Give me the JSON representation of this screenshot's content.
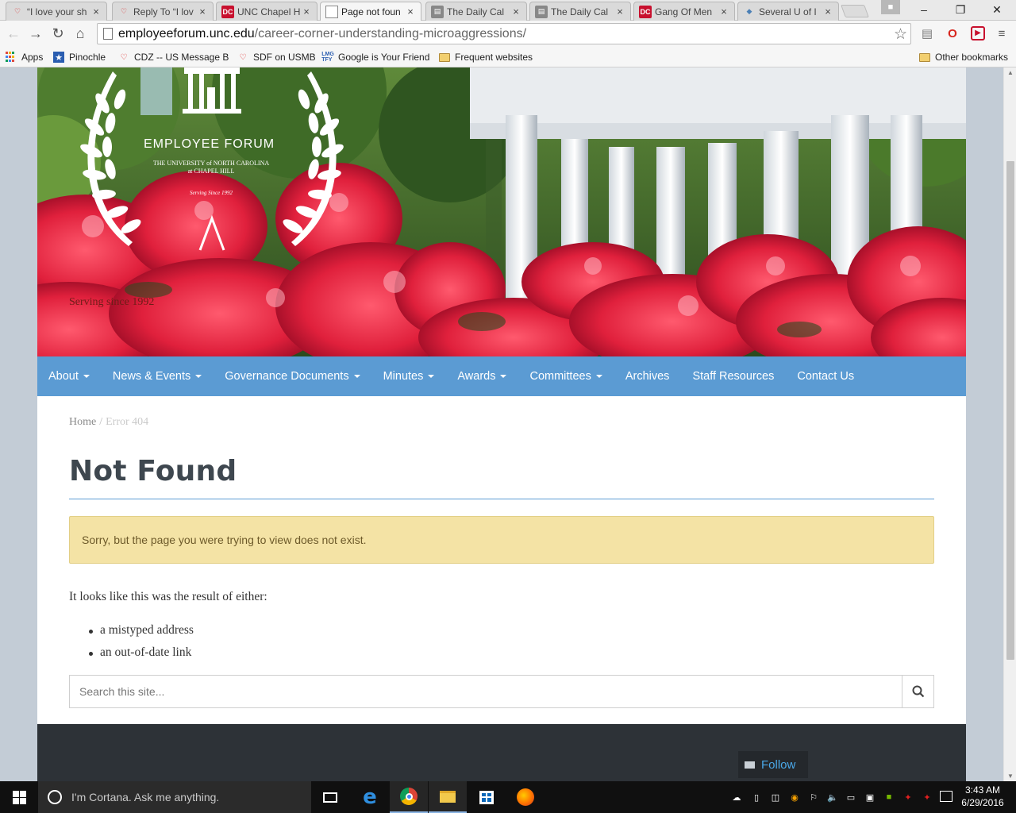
{
  "browser": {
    "tabs": [
      {
        "title": "“I love your sh",
        "favicon": "lips"
      },
      {
        "title": "Reply To “I lov",
        "favicon": "lips"
      },
      {
        "title": "UNC Chapel H",
        "favicon": "dc"
      },
      {
        "title": "Page not foun",
        "favicon": "page",
        "active": true
      },
      {
        "title": "The Daily Cal",
        "favicon": "doc"
      },
      {
        "title": "The Daily Cal",
        "favicon": "doc"
      },
      {
        "title": "Gang Of Men",
        "favicon": "dc"
      },
      {
        "title": "Several U of I",
        "favicon": "fish"
      }
    ],
    "close_glyph": "×",
    "url_host": "employeeforum.unc.edu",
    "url_path": "/career-corner-understanding-microaggressions/",
    "bookmarks": [
      {
        "label": "Apps",
        "icon": "apps-grid"
      },
      {
        "label": "Pinochle",
        "icon": "star-icon"
      },
      {
        "label": "CDZ -- US Message B",
        "icon": "lips"
      },
      {
        "label": "SDF on USMB",
        "icon": "lips"
      },
      {
        "label": "Google is Your Friend",
        "icon": "lmgtfy"
      },
      {
        "label": "Frequent websites",
        "icon": "folder"
      }
    ],
    "other_bookmarks": "Other bookmarks"
  },
  "site": {
    "logo": {
      "name": "EMPLOYEE FORUM",
      "sub1": "THE UNIVERSITY of NORTH CAROLINA",
      "sub2": "at CHAPEL HILL",
      "since": "Serving Since 1992"
    },
    "tagline": "Serving since 1992",
    "nav": [
      {
        "label": "About",
        "dropdown": true
      },
      {
        "label": "News & Events",
        "dropdown": true
      },
      {
        "label": "Governance Documents",
        "dropdown": true
      },
      {
        "label": "Minutes",
        "dropdown": true
      },
      {
        "label": "Awards",
        "dropdown": true
      },
      {
        "label": "Committees",
        "dropdown": true
      },
      {
        "label": "Archives",
        "dropdown": false
      },
      {
        "label": "Staff Resources",
        "dropdown": false
      },
      {
        "label": "Contact Us",
        "dropdown": false
      }
    ],
    "breadcrumb": {
      "home": "Home",
      "separator": "/",
      "current": "Error 404"
    },
    "page_title": "Not Found",
    "alert": "Sorry, but the page you were trying to view does not exist.",
    "intro": "It looks like this was the result of either:",
    "reasons": [
      "a mistyped address",
      "an out-of-date link"
    ],
    "search": {
      "placeholder": "Search this site..."
    },
    "follow_label": "Follow",
    "colors": {
      "nav": "#5b9bd3",
      "title": "#3e474f",
      "alert_bg": "#f4e3a5",
      "footer": "#2d3237",
      "follow": "#4aa8e8"
    }
  },
  "taskbar": {
    "cortana_placeholder": "I'm Cortana. Ask me anything.",
    "time": "3:43 AM",
    "date": "6/29/2016"
  }
}
